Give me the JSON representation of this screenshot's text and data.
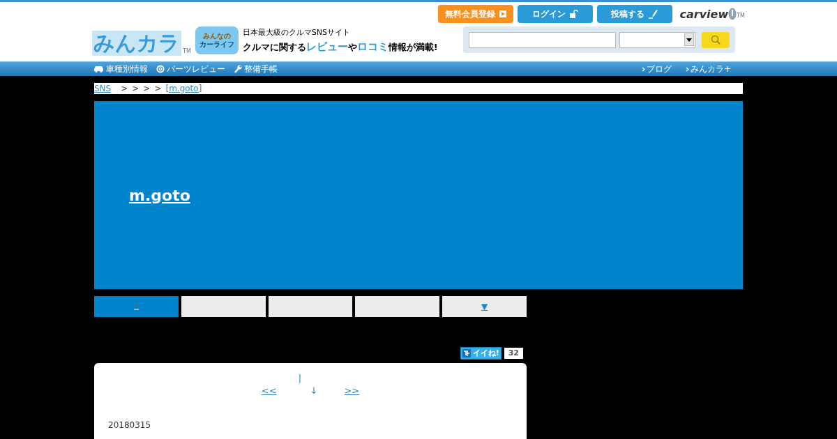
{
  "header": {
    "logo": "みんカラ",
    "logo_tm": "TM",
    "badge_lines": [
      "みんなの",
      "カーライフ"
    ],
    "tagline": "日本最大級のクルマSNSサイト",
    "headline": [
      {
        "text": "クルマに関する",
        "accent": false
      },
      {
        "text": "レビュー",
        "accent": true
      },
      {
        "text": "や",
        "accent": false
      },
      {
        "text": "ロコミ",
        "accent": true
      },
      {
        "text": "情報が満載!",
        "accent": false
      }
    ],
    "buttons": [
      {
        "label": "無料会員登録",
        "kind": "register"
      },
      {
        "label": "ログイン",
        "kind": "login"
      },
      {
        "label": "投稿する",
        "kind": "post"
      }
    ],
    "brand": "carview",
    "brand_tm": "TM"
  },
  "nav": {
    "left": [
      {
        "label": "車種別情報",
        "kind": "car"
      },
      {
        "label": "パーツレビュー",
        "kind": "wheel"
      },
      {
        "label": "整備手帳",
        "kind": "wrench"
      }
    ],
    "right": [
      "ブログ",
      "みんカラ+"
    ]
  },
  "breadcrumb": [
    {
      "label": "SNS",
      "kind": "link"
    },
    {
      "label": ">",
      "kind": "sep"
    },
    {
      "label": ">",
      "kind": "sep"
    },
    {
      "label": ">",
      "kind": "sep"
    },
    {
      "label": ">",
      "kind": "sep"
    },
    {
      "label": "[m.goto]",
      "kind": "link"
    }
  ],
  "profile": {
    "name": "m.goto"
  },
  "tabs": [
    {
      "kind": "icon",
      "selected": true
    },
    {
      "kind": "blank",
      "selected": false
    },
    {
      "kind": "blank",
      "selected": false
    },
    {
      "kind": "blank",
      "selected": false
    },
    {
      "kind": "text",
      "label": "▼",
      "selected": false
    }
  ],
  "like": {
    "label": "イイね!",
    "count": "32"
  },
  "pager": {
    "up": "|",
    "prev": "<<",
    "down": "↓",
    "next": ">>"
  },
  "post": {
    "date": "20180315"
  }
}
